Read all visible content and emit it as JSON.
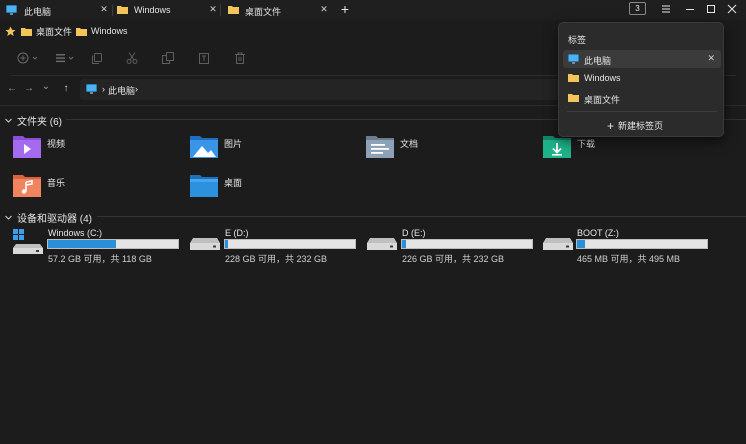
{
  "tabs": [
    {
      "label": "此电脑",
      "icon": "pc-icon",
      "active": true
    },
    {
      "label": "Windows",
      "icon": "folder-icon",
      "active": false
    },
    {
      "label": "桌面文件",
      "icon": "folder-icon",
      "active": false
    }
  ],
  "tab_close_glyph": "✕",
  "tab_add_glyph": "+",
  "tab_count": "3",
  "bookmarks": [
    {
      "label": "桌面文件",
      "icon": "folder-icon"
    },
    {
      "label": "Windows",
      "icon": "folder-icon"
    }
  ],
  "toolbar": {
    "icons": [
      "new-icon",
      "view-icon",
      "copy-icon",
      "cut-icon",
      "copy-path-icon",
      "rename-icon",
      "delete-icon"
    ]
  },
  "address": {
    "nav": {
      "back": "←",
      "forward": "→",
      "history": "⌄",
      "up": "↑"
    },
    "crumb": "此电脑",
    "crumb_sep": "›"
  },
  "folders_section": {
    "title": "文件夹 (6)",
    "items": [
      {
        "label": "视频",
        "icon": "videos-folder-icon"
      },
      {
        "label": "图片",
        "icon": "pictures-folder-icon"
      },
      {
        "label": "文档",
        "icon": "documents-folder-icon"
      },
      {
        "label": "下载",
        "icon": "downloads-folder-icon"
      },
      {
        "label": "音乐",
        "icon": "music-folder-icon"
      },
      {
        "label": "桌面",
        "icon": "desktop-folder-icon"
      }
    ]
  },
  "drives_section": {
    "title": "设备和驱动器 (4)",
    "items": [
      {
        "name": "Windows (C:)",
        "used_fraction": 0.52,
        "info": "57.2 GB 可用，共 118 GB",
        "icon": "system-drive-icon"
      },
      {
        "name": "E (D:)",
        "used_fraction": 0.02,
        "info": "228 GB 可用，共 232 GB",
        "icon": "drive-icon"
      },
      {
        "name": "D (E:)",
        "used_fraction": 0.03,
        "info": "226 GB 可用，共 232 GB",
        "icon": "drive-icon"
      },
      {
        "name": "BOOT (Z:)",
        "used_fraction": 0.06,
        "info": "465 MB 可用，共 495 MB",
        "icon": "drive-icon"
      }
    ]
  },
  "tab_menu": {
    "title": "标签",
    "items": [
      {
        "label": "此电脑",
        "icon": "pc-icon",
        "active": true
      },
      {
        "label": "Windows",
        "icon": "folder-icon",
        "active": false
      },
      {
        "label": "桌面文件",
        "icon": "folder-icon",
        "active": false
      }
    ],
    "new_tab_label": "新建标签页",
    "new_tab_glyph": "+"
  },
  "colors": {
    "background": "#1c1c1c",
    "accent": "#2a8fd6",
    "folder": "#f2c45a"
  }
}
